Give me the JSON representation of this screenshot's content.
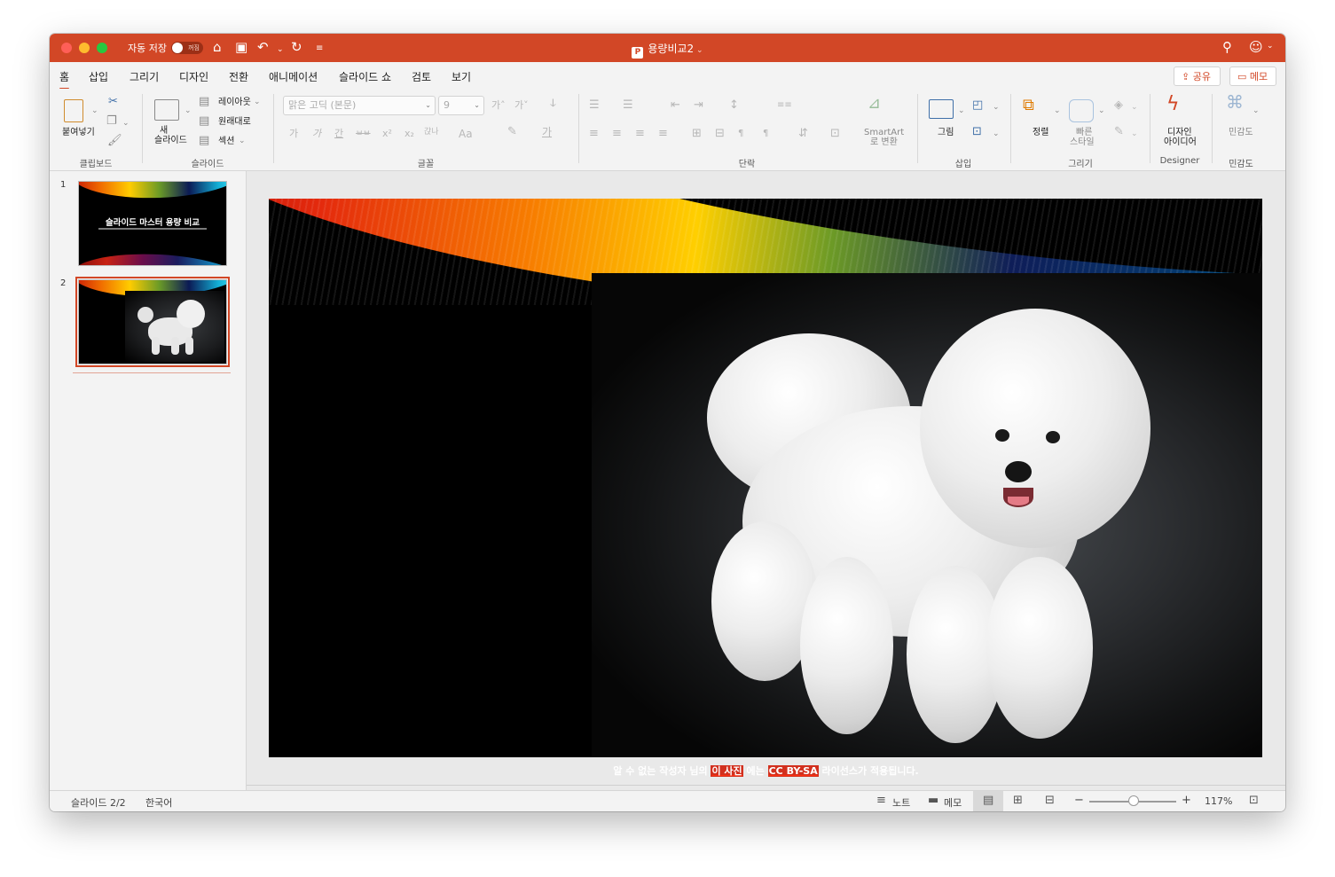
{
  "titlebar": {
    "autosave_label": "자동 저장",
    "autosave_state": "꺼짐",
    "doc_title": "용량비교2",
    "doc_icon": "P"
  },
  "tabs": [
    {
      "label": "홈",
      "active": true
    },
    {
      "label": "삽입"
    },
    {
      "label": "그리기"
    },
    {
      "label": "디자인"
    },
    {
      "label": "전환"
    },
    {
      "label": "애니메이션"
    },
    {
      "label": "슬라이드 쇼"
    },
    {
      "label": "검토"
    },
    {
      "label": "보기"
    }
  ],
  "top_buttons": {
    "share": "공유",
    "comments": "메모"
  },
  "ribbon": {
    "clipboard": {
      "paste": "붙여넣기",
      "group": "클립보드"
    },
    "slides": {
      "new_slide_line1": "새",
      "new_slide_line2": "슬라이드",
      "layout": "레이아웃",
      "reset": "원래대로",
      "section": "섹션",
      "group": "슬라이드"
    },
    "font": {
      "font_name_placeholder": "맑은 고딕 (본문)",
      "font_size": "9",
      "group": "글꼴",
      "glyphs": [
        "가",
        "가",
        "간",
        "ㅂㅂ",
        "x²",
        "x₂",
        "갅나",
        "Aa",
        "가"
      ]
    },
    "paragraph": {
      "smartart_line1": "SmartArt",
      "smartart_line2": "로 변환",
      "group": "단락"
    },
    "insert": {
      "picture": "그림",
      "group": "삽입"
    },
    "drawing": {
      "arrange": "정렬",
      "quick_styles_line1": "빠른",
      "quick_styles_line2": "스타일",
      "group": "그리기"
    },
    "designer": {
      "ideas_line1": "디자인",
      "ideas_line2": "아이디어",
      "group": "Designer"
    },
    "sensitivity": {
      "label": "민감도",
      "group": "민감도"
    }
  },
  "thumbnails": [
    {
      "number": "1",
      "title": "슬라이드 마스터 용량 비교"
    },
    {
      "number": "2",
      "selected": true
    }
  ],
  "slide": {
    "caption_pre": "알 수 없는 작성자 님의 ",
    "caption_link1": "이 사진",
    "caption_mid": " 에는 ",
    "caption_link2": "CC BY-SA",
    "caption_post": " 라이선스가 적용됩니다."
  },
  "status": {
    "slide_counter": "슬라이드 2/2",
    "language": "한국어",
    "notes": "노트",
    "comments": "메모",
    "zoom_minus": "−",
    "zoom_plus": "+",
    "zoom": "117%"
  },
  "colors": {
    "accent": "#d24726",
    "titlebar": "#d24726",
    "ribbon_bg": "#f3f3f3"
  }
}
